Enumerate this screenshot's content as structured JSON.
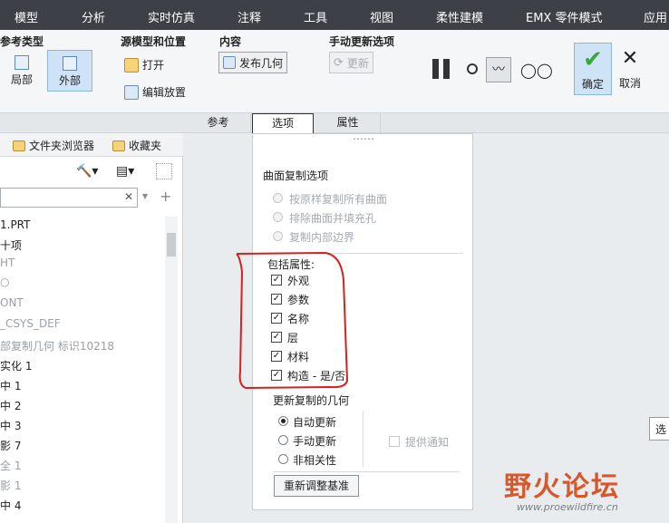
{
  "menu": [
    "模型",
    "分析",
    "实时仿真",
    "注释",
    "工具",
    "视图",
    "柔性建模",
    "EMX 零件模式",
    "应用"
  ],
  "ribbon": {
    "ref_type_title": "参考类型",
    "local_label": "局部",
    "external_label": "外部",
    "source_title": "源模型和位置",
    "open_label": "打开",
    "edit_place_label": "编辑放置",
    "content_title": "内容",
    "publish_geom_label": "发布几何",
    "manual_update_title": "手动更新选项",
    "update_label": "更新",
    "confirm_label": "确定",
    "cancel_label": "取消"
  },
  "tabs": [
    "参考",
    "选项",
    "属性"
  ],
  "left_panel": {
    "folder_browser": "文件夹浏览器",
    "favorites": "收藏夹",
    "items": [
      "1.PRT",
      "十项",
      "HT",
      "○",
      "ONT",
      "_CSYS_DEF",
      "部复制几何 标识10218",
      "实化 1",
      "中 1",
      "中 2",
      "中 3",
      "影 7",
      "全 1",
      "影 1",
      "中 4"
    ]
  },
  "popup": {
    "dots": "⋯⋯",
    "surface_copy_title": "曲面复制选项",
    "radio_copy_all": "按原样复制所有曲面",
    "radio_exclude": "排除曲面并填充孔",
    "radio_inner": "复制内部边界",
    "include_attrs": "包括属性:",
    "checks": [
      "外观",
      "参数",
      "名称",
      "层",
      "材料",
      "构造 - 是/否"
    ],
    "update_title": "更新复制的几何",
    "radio_auto": "自动更新",
    "radio_manual": "手动更新",
    "radio_indep": "非相关性",
    "notify": "提供通知",
    "readjust": "重新调整基准"
  },
  "watermark": {
    "title": "野火论坛",
    "url": "www.proewildfire.cn"
  },
  "tooltip_partial": "选"
}
